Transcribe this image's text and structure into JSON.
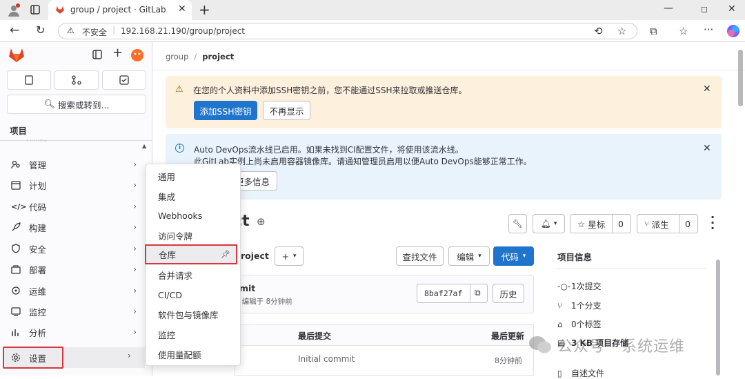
{
  "browser": {
    "tab_title": "group / project · GitLab",
    "security_label": "不安全",
    "url": "192.168.21.190/group/project"
  },
  "sidebar": {
    "search_label": "搜索或转到...",
    "section_title": "项目",
    "faded_label": "Pinned",
    "items": [
      {
        "label": "管理",
        "icon": "briefcase-icon"
      },
      {
        "label": "计划",
        "icon": "calendar-icon"
      },
      {
        "label": "代码",
        "icon": "code-icon"
      },
      {
        "label": "构建",
        "icon": "rocket-icon"
      },
      {
        "label": "安全",
        "icon": "shield-icon"
      },
      {
        "label": "部署",
        "icon": "deploy-icon"
      },
      {
        "label": "运维",
        "icon": "monitor-icon"
      },
      {
        "label": "监控",
        "icon": "chart-icon"
      },
      {
        "label": "分析",
        "icon": "analytics-icon"
      },
      {
        "label": "设置",
        "icon": "gear-icon"
      }
    ]
  },
  "flyout": {
    "items": [
      "通用",
      "集成",
      "Webhooks",
      "访问令牌",
      "仓库",
      "合并请求",
      "CI/CD",
      "软件包与镜像库",
      "监控",
      "使用量配额"
    ],
    "highlighted": "仓库"
  },
  "breadcrumb": {
    "group": "group",
    "separator": "/",
    "project": "project"
  },
  "ssh_banner": {
    "text": "在您的个人资料中添加SSH密钥之前，您不能通过SSH来拉取或推送仓库。",
    "add_button": "添加SSH密钥",
    "dismiss_button": "不再显示"
  },
  "devops_banner": {
    "line1": "Auto DevOps流水线已启用。如果未找到CI配置文件，将使用该流水线。",
    "line2": "此GitLab实例上尚未启用容器镜像库。请通知管理员启用以便Auto DevOps能够正常工作。",
    "more_button": "更多信息"
  },
  "project": {
    "title_fragment": "ct",
    "star_label": "星标",
    "star_count": "0",
    "fork_label": "派生",
    "fork_count": "0",
    "path_fragment": "roject",
    "find_file": "查找文件",
    "edit": "编辑",
    "code": "代码"
  },
  "commit": {
    "message_fragment": "mit",
    "meta_fragment": "r 编辑于 8分钟前",
    "sha": "8baf27af",
    "history": "历史"
  },
  "file_table": {
    "col_last_commit": "最后提交",
    "col_last_update": "最后更新",
    "row_commit": "Initial commit",
    "row_time": "8分钟前"
  },
  "project_info": {
    "title": "项目信息",
    "commits": "1次提交",
    "branches": "1个分支",
    "tags": "0个标签",
    "storage": "3 KB 项目存储",
    "readme": "自述文件"
  },
  "watermark": "公众号 · 系统运维"
}
